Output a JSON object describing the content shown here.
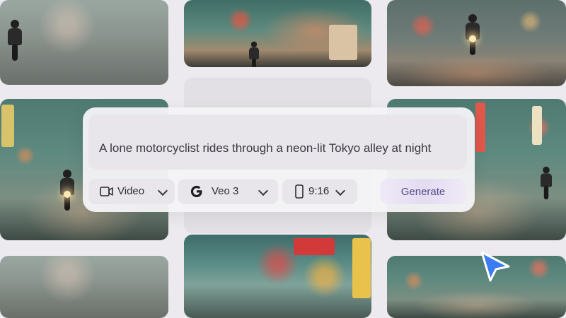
{
  "prompt": {
    "text": "A lone motorcyclist rides through a neon-lit Tokyo alley at night"
  },
  "controls": {
    "type": {
      "label": "Video",
      "icon": "video-camera-icon"
    },
    "model": {
      "label": "Veo 3",
      "icon": "google-g-icon"
    },
    "aspect": {
      "label": "9:16",
      "icon": "phone-portrait-icon"
    },
    "generate_label": "Generate"
  },
  "colors": {
    "accent": "#5a4a8a",
    "cursor": "#3b7cf2",
    "background": "#eceaee"
  }
}
